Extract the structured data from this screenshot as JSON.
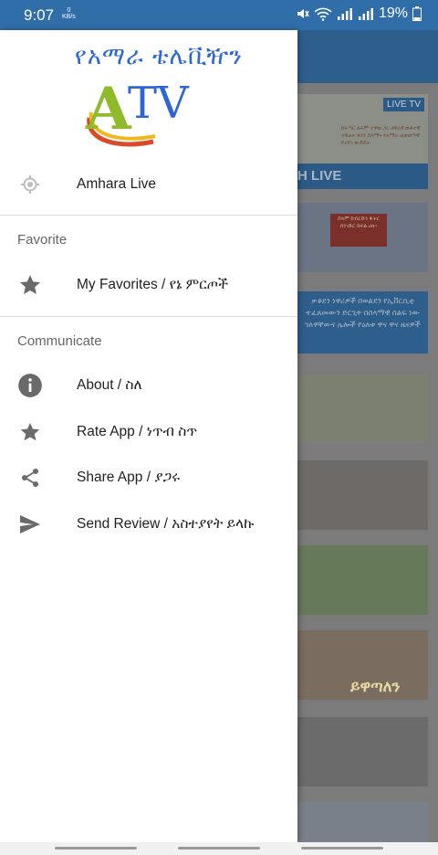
{
  "status_bar": {
    "time": "9:07",
    "data_rate": "0",
    "data_unit": "KB/s",
    "battery": "19%"
  },
  "drawer": {
    "logo_text": "የአማራ ቴሌቪዥን",
    "logo_letters": "ATV",
    "live_item": {
      "label": "Amhara Live",
      "icon": "location-target-icon"
    },
    "section_favorite": "Favorite",
    "favorites_item": {
      "label": "My Favorites / የኔ ምርጦች",
      "icon": "star-icon"
    },
    "section_communicate": "Communicate",
    "about_item": {
      "label": "About / ስለ",
      "icon": "info-icon"
    },
    "rate_item": {
      "label": "Rate App / ነጥብ ስጥ",
      "icon": "star-icon"
    },
    "share_item": {
      "label": "Share App / ያጋሩ",
      "icon": "share-icon"
    },
    "review_item": {
      "label": "Send Review / አስተያየት ይላኩ",
      "icon": "send-icon"
    }
  },
  "background": {
    "badge": "LIVE TV",
    "live_label": "H LIVE",
    "card1_text": "ከፍጣር ለፍም ተዋወ ጋር ሀዋሪዳ ወቶተዊ ንዱልና ቶንን ሰላማና የአማራ ልወወጣዊ የተደገ ውይይት",
    "card2_text": "ሰላም ከብርድን ፋትር በንገድር ከፍል ሀለ፡፡",
    "card3_text": "ቃቆደን ነዋሪዎች በወልደን የኢቨርሲቲ ተፈጸመውን ድርጊት በሰላማዊ ሰልፍ ነው ገለዋቸውና ሌሎች የዕለቱ ዋና ዋና ዜናዎች",
    "poster_title": "ይዋጣለን"
  },
  "colors": {
    "status_bar": "#2f6ea8",
    "logo_blue": "#2c66d6",
    "icon_grey": "#6a6a6a"
  }
}
